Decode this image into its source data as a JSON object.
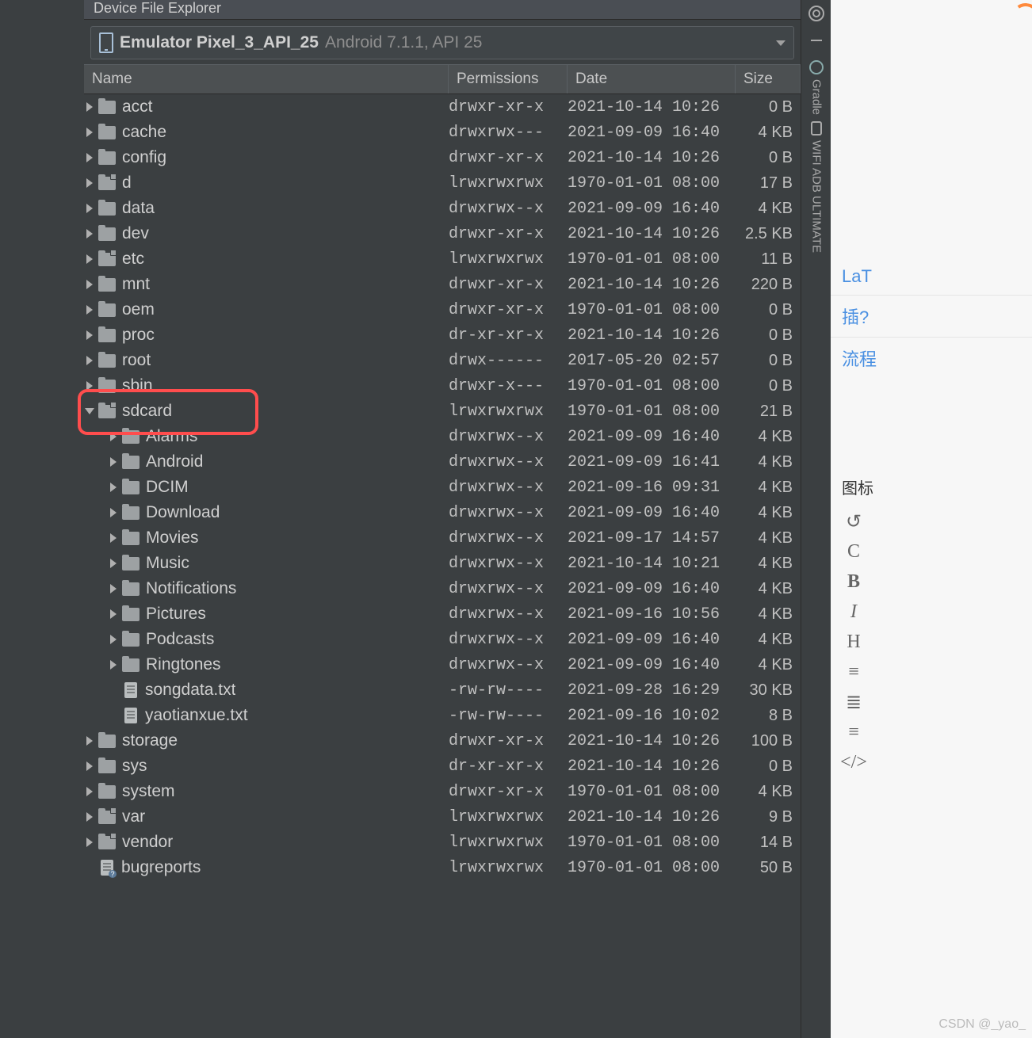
{
  "header_title": "Device File Explorer",
  "device": {
    "name": "Emulator Pixel_3_API_25",
    "sub": "Android 7.1.1, API 25"
  },
  "columns": {
    "name": "Name",
    "permissions": "Permissions",
    "date": "Date",
    "size": "Size"
  },
  "right_strip": {
    "gradle": "Gradle",
    "wifi": "WIFI ADB ULTIMATE"
  },
  "right_pane": {
    "items_top": [
      "LaT",
      "插?",
      "流程"
    ],
    "section": "图标",
    "glyphs": [
      "↺",
      "C",
      "B",
      "I",
      "H",
      "≡",
      "≣",
      "≡",
      "</>"
    ]
  },
  "watermark": "CSDN @_yao_",
  "rows": [
    {
      "depth": 0,
      "expanded": false,
      "icon": "folder",
      "name": "acct",
      "perm": "drwxr-xr-x",
      "date": "2021-10-14 10:26",
      "size": "0 B"
    },
    {
      "depth": 0,
      "expanded": false,
      "icon": "folder",
      "name": "cache",
      "perm": "drwxrwx---",
      "date": "2021-09-09 16:40",
      "size": "4 KB"
    },
    {
      "depth": 0,
      "expanded": false,
      "icon": "folder",
      "name": "config",
      "perm": "drwxr-xr-x",
      "date": "2021-10-14 10:26",
      "size": "0 B"
    },
    {
      "depth": 0,
      "expanded": false,
      "icon": "folder-link",
      "name": "d",
      "perm": "lrwxrwxrwx",
      "date": "1970-01-01 08:00",
      "size": "17 B"
    },
    {
      "depth": 0,
      "expanded": false,
      "icon": "folder",
      "name": "data",
      "perm": "drwxrwx--x",
      "date": "2021-09-09 16:40",
      "size": "4 KB"
    },
    {
      "depth": 0,
      "expanded": false,
      "icon": "folder",
      "name": "dev",
      "perm": "drwxr-xr-x",
      "date": "2021-10-14 10:26",
      "size": "2.5 KB"
    },
    {
      "depth": 0,
      "expanded": false,
      "icon": "folder-link",
      "name": "etc",
      "perm": "lrwxrwxrwx",
      "date": "1970-01-01 08:00",
      "size": "11 B"
    },
    {
      "depth": 0,
      "expanded": false,
      "icon": "folder",
      "name": "mnt",
      "perm": "drwxr-xr-x",
      "date": "2021-10-14 10:26",
      "size": "220 B"
    },
    {
      "depth": 0,
      "expanded": false,
      "icon": "folder",
      "name": "oem",
      "perm": "drwxr-xr-x",
      "date": "1970-01-01 08:00",
      "size": "0 B"
    },
    {
      "depth": 0,
      "expanded": false,
      "icon": "folder",
      "name": "proc",
      "perm": "dr-xr-xr-x",
      "date": "2021-10-14 10:26",
      "size": "0 B"
    },
    {
      "depth": 0,
      "expanded": false,
      "icon": "folder",
      "name": "root",
      "perm": "drwx------",
      "date": "2017-05-20 02:57",
      "size": "0 B"
    },
    {
      "depth": 0,
      "expanded": false,
      "icon": "folder",
      "name": "sbin",
      "perm": "drwxr-x---",
      "date": "1970-01-01 08:00",
      "size": "0 B"
    },
    {
      "depth": 0,
      "expanded": true,
      "icon": "folder-link",
      "name": "sdcard",
      "perm": "lrwxrwxrwx",
      "date": "1970-01-01 08:00",
      "size": "21 B",
      "hl": true
    },
    {
      "depth": 1,
      "expanded": false,
      "icon": "folder",
      "name": "Alarms",
      "perm": "drwxrwx--x",
      "date": "2021-09-09 16:40",
      "size": "4 KB"
    },
    {
      "depth": 1,
      "expanded": false,
      "icon": "folder",
      "name": "Android",
      "perm": "drwxrwx--x",
      "date": "2021-09-09 16:41",
      "size": "4 KB"
    },
    {
      "depth": 1,
      "expanded": false,
      "icon": "folder",
      "name": "DCIM",
      "perm": "drwxrwx--x",
      "date": "2021-09-16 09:31",
      "size": "4 KB"
    },
    {
      "depth": 1,
      "expanded": false,
      "icon": "folder",
      "name": "Download",
      "perm": "drwxrwx--x",
      "date": "2021-09-09 16:40",
      "size": "4 KB"
    },
    {
      "depth": 1,
      "expanded": false,
      "icon": "folder",
      "name": "Movies",
      "perm": "drwxrwx--x",
      "date": "2021-09-17 14:57",
      "size": "4 KB"
    },
    {
      "depth": 1,
      "expanded": false,
      "icon": "folder",
      "name": "Music",
      "perm": "drwxrwx--x",
      "date": "2021-10-14 10:21",
      "size": "4 KB"
    },
    {
      "depth": 1,
      "expanded": false,
      "icon": "folder",
      "name": "Notifications",
      "perm": "drwxrwx--x",
      "date": "2021-09-09 16:40",
      "size": "4 KB"
    },
    {
      "depth": 1,
      "expanded": false,
      "icon": "folder",
      "name": "Pictures",
      "perm": "drwxrwx--x",
      "date": "2021-09-16 10:56",
      "size": "4 KB"
    },
    {
      "depth": 1,
      "expanded": false,
      "icon": "folder",
      "name": "Podcasts",
      "perm": "drwxrwx--x",
      "date": "2021-09-09 16:40",
      "size": "4 KB"
    },
    {
      "depth": 1,
      "expanded": false,
      "icon": "folder",
      "name": "Ringtones",
      "perm": "drwxrwx--x",
      "date": "2021-09-09 16:40",
      "size": "4 KB"
    },
    {
      "depth": 1,
      "expanded": null,
      "icon": "file",
      "name": "songdata.txt",
      "perm": "-rw-rw----",
      "date": "2021-09-28 16:29",
      "size": "30 KB"
    },
    {
      "depth": 1,
      "expanded": null,
      "icon": "file",
      "name": "yaotianxue.txt",
      "perm": "-rw-rw----",
      "date": "2021-09-16 10:02",
      "size": "8 B"
    },
    {
      "depth": 0,
      "expanded": false,
      "icon": "folder",
      "name": "storage",
      "perm": "drwxr-xr-x",
      "date": "2021-10-14 10:26",
      "size": "100 B"
    },
    {
      "depth": 0,
      "expanded": false,
      "icon": "folder",
      "name": "sys",
      "perm": "dr-xr-xr-x",
      "date": "2021-10-14 10:26",
      "size": "0 B"
    },
    {
      "depth": 0,
      "expanded": false,
      "icon": "folder",
      "name": "system",
      "perm": "drwxr-xr-x",
      "date": "1970-01-01 08:00",
      "size": "4 KB"
    },
    {
      "depth": 0,
      "expanded": false,
      "icon": "folder-link",
      "name": "var",
      "perm": "lrwxrwxrwx",
      "date": "2021-10-14 10:26",
      "size": "9 B"
    },
    {
      "depth": 0,
      "expanded": false,
      "icon": "folder-link",
      "name": "vendor",
      "perm": "lrwxrwxrwx",
      "date": "1970-01-01 08:00",
      "size": "14 B"
    },
    {
      "depth": 0,
      "expanded": null,
      "icon": "file-link",
      "name": "bugreports",
      "perm": "lrwxrwxrwx",
      "date": "1970-01-01 08:00",
      "size": "50 B"
    }
  ]
}
